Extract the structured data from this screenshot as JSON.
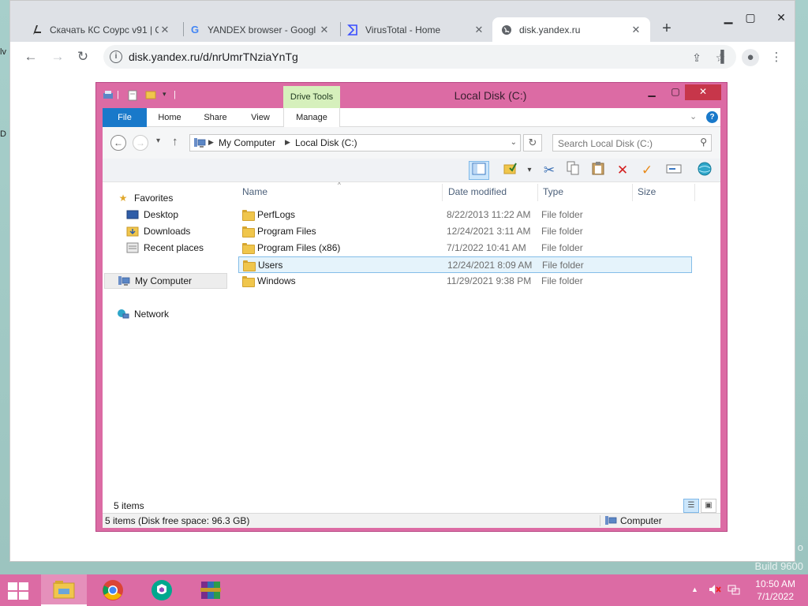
{
  "desktop": {
    "left_edge_top": "lv",
    "left_edge_bottom": "D",
    "watermark_line1": "o",
    "watermark_line2": "Build 9600"
  },
  "browser": {
    "tabs": [
      {
        "label": "Скачать КС Соурс v91 | C",
        "favicon": "cs-logo-icon",
        "active": false
      },
      {
        "label": "YANDEX browser - Googl",
        "favicon": "google-icon",
        "active": false
      },
      {
        "label": "VirusTotal - Home",
        "favicon": "virustotal-icon",
        "active": false
      },
      {
        "label": "disk.yandex.ru",
        "favicon": "globe-icon",
        "active": true
      }
    ],
    "new_tab": "+",
    "address": "disk.yandex.ru/d/nrUmrTNziaYnTg",
    "colors": {
      "tabstrip": "#dee1e6",
      "omnibox": "#f1f3f4"
    }
  },
  "explorer": {
    "title": "Local Disk (C:)",
    "contextual_tab_group": "Drive Tools",
    "ribbon_tabs": [
      "File",
      "Home",
      "Share",
      "View",
      "Manage"
    ],
    "breadcrumb": [
      "My Computer",
      "Local Disk (C:)"
    ],
    "search_placeholder": "Search Local Disk (C:)",
    "navigation": {
      "favorites": "Favorites",
      "favorites_items": [
        "Desktop",
        "Downloads",
        "Recent places"
      ],
      "computer": "My Computer",
      "network": "Network"
    },
    "columns": [
      "Name",
      "Date modified",
      "Type",
      "Size"
    ],
    "files": [
      {
        "name": "PerfLogs",
        "date": "8/22/2013 11:22 AM",
        "type": "File folder",
        "selected": false
      },
      {
        "name": "Program Files",
        "date": "12/24/2021 3:11 AM",
        "type": "File folder",
        "selected": false
      },
      {
        "name": "Program Files (x86)",
        "date": "7/1/2022 10:41 AM",
        "type": "File folder",
        "selected": false
      },
      {
        "name": "Users",
        "date": "12/24/2021 8:09 AM",
        "type": "File folder",
        "selected": true
      },
      {
        "name": "Windows",
        "date": "11/29/2021 9:38 PM",
        "type": "File folder",
        "selected": false
      }
    ],
    "item_count": "5 items",
    "status": "5 items (Disk free space: 96.3 GB)",
    "status_right": "Computer",
    "colors": {
      "frame": "#dc6ba4",
      "file_tab": "#1979ca",
      "drive_tools": "#d6f0bc"
    }
  },
  "taskbar": {
    "apps": [
      "file-explorer-icon",
      "chrome-icon",
      "kaspersky-icon",
      "winrar-icon"
    ],
    "time": "10:50 AM",
    "date": "7/1/2022",
    "colors": {
      "background": "#dc6ba4"
    }
  }
}
